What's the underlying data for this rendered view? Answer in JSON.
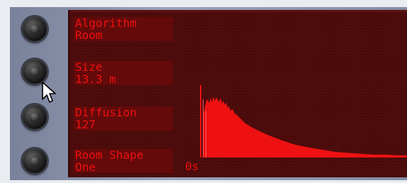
{
  "params": [
    {
      "name": "Algorithm",
      "value": "Room"
    },
    {
      "name": "Size",
      "value": "13.3 m"
    },
    {
      "name": "Diffusion",
      "value": "127"
    },
    {
      "name": "Room Shape",
      "value": "One"
    }
  ],
  "graph": {
    "time_label": "0s",
    "color": "#ee1111"
  },
  "colors": {
    "display_bg": "#4a0a0a",
    "text": "#f01010",
    "panel": "#8c94aa"
  }
}
